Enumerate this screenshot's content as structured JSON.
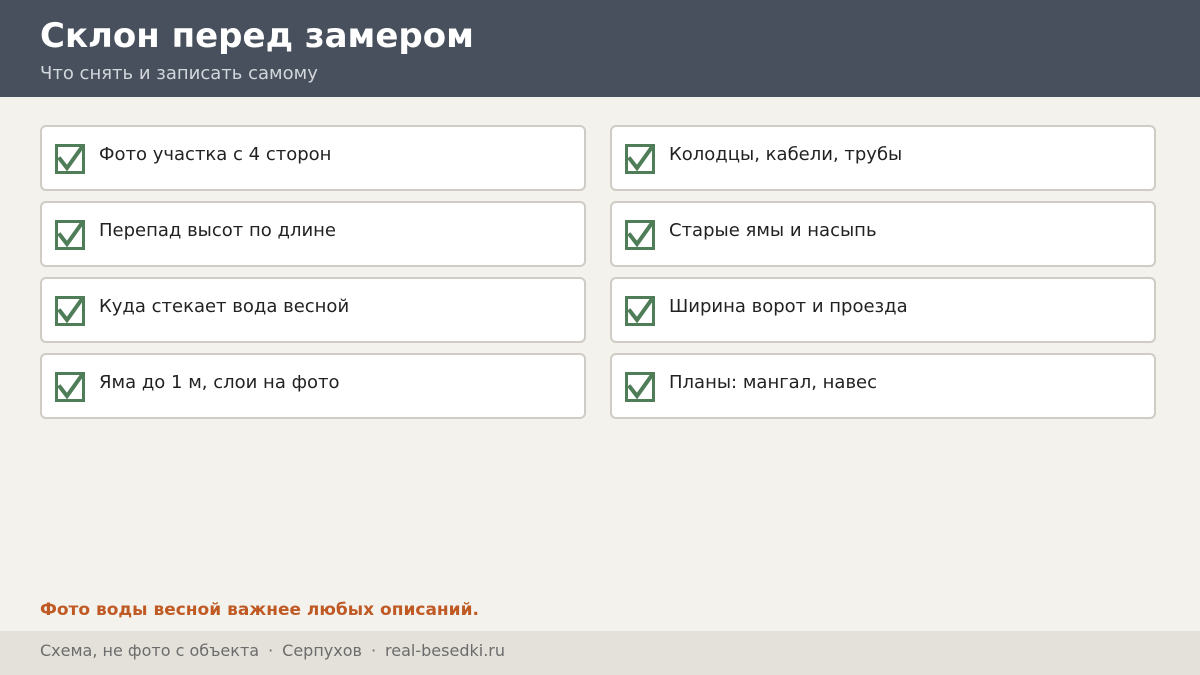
{
  "header": {
    "title": "Склон перед замером",
    "subtitle": "Что снять и записать самому"
  },
  "checklist": [
    {
      "label": "Фото участка с 4 сторон",
      "checked": true,
      "icon": "checkbox-checked-icon"
    },
    {
      "label": "Колодцы, кабели, трубы",
      "checked": true,
      "icon": "checkbox-checked-icon"
    },
    {
      "label": "Перепад высот по длине",
      "checked": true,
      "icon": "checkbox-checked-icon"
    },
    {
      "label": "Старые ямы и насыпь",
      "checked": true,
      "icon": "checkbox-checked-icon"
    },
    {
      "label": "Куда стекает вода весной",
      "checked": true,
      "icon": "checkbox-checked-icon"
    },
    {
      "label": "Ширина ворот и проезда",
      "checked": true,
      "icon": "checkbox-checked-icon"
    },
    {
      "label": "Яма до 1 м, слои на фото",
      "checked": true,
      "icon": "checkbox-checked-icon"
    },
    {
      "label": "Планы: мангал, навес",
      "checked": true,
      "icon": "checkbox-checked-icon"
    }
  ],
  "note": "Фото воды весной важнее любых описаний.",
  "footer": {
    "part1": "Схема, не фото с объекта",
    "separator": "·",
    "part2": "Серпухов",
    "part3": "real-besedki.ru"
  },
  "colors": {
    "header_bg": "#47505c",
    "page_bg": "#f4f2ed",
    "check_green": "#4e7d58",
    "note_accent": "#bf5a24",
    "footer_bg": "#e4e1da"
  }
}
